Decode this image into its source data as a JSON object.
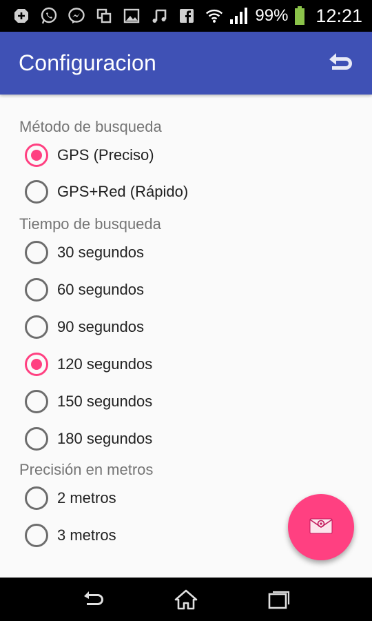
{
  "status_bar": {
    "battery_percent": "99%",
    "time": "12:21",
    "notification_icons": [
      "add-icon",
      "whatsapp-icon",
      "messenger-icon",
      "copy-icon",
      "image-icon",
      "music-icon",
      "facebook-icon"
    ],
    "battery_level": 0.99
  },
  "app_bar": {
    "title": "Configuracion",
    "back_icon": "undo-arrow-icon"
  },
  "sections": {
    "search_method": {
      "header": "Método de busqueda",
      "options": [
        "GPS (Preciso)",
        "GPS+Red (Rápido)"
      ],
      "selected_index": 0
    },
    "search_time": {
      "header": "Tiempo de busqueda",
      "options": [
        "30 segundos",
        "60 segundos",
        "90 segundos",
        "120 segundos",
        "150 segundos",
        "180 segundos"
      ],
      "selected_index": 3
    },
    "precision": {
      "header": "Precisión en metros",
      "options": [
        "2 metros",
        "3 metros"
      ],
      "selected_index": -1
    }
  },
  "fab": {
    "icon": "email-icon"
  },
  "nav_bar": {
    "icons": [
      "back-icon",
      "home-icon",
      "recents-icon"
    ]
  },
  "colors": {
    "primary": "#3f51b5",
    "accent": "#ff4081",
    "background": "#fafafa",
    "section_text": "#757575",
    "radio_off": "#6d6d6d"
  }
}
